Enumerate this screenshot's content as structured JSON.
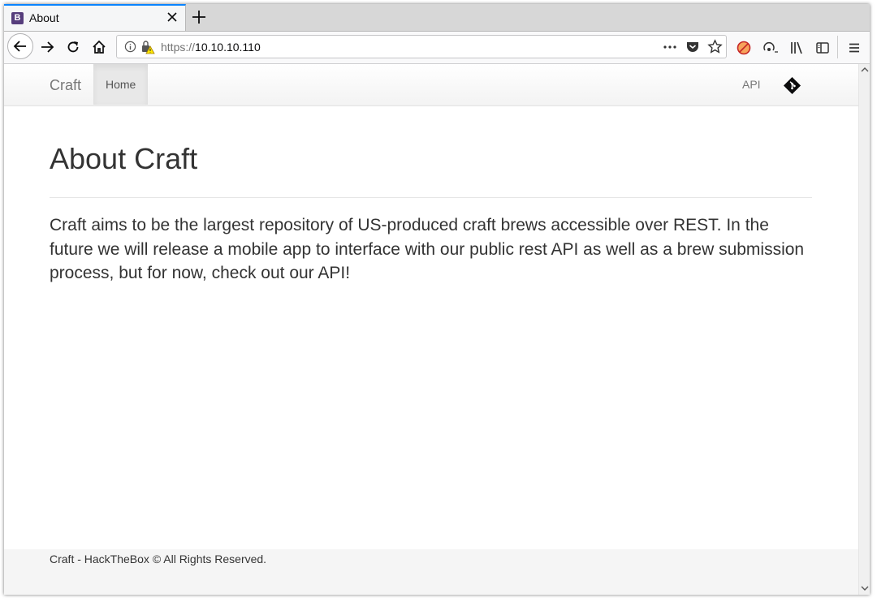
{
  "browser": {
    "tab": {
      "title": "About",
      "favicon_letter": "B"
    },
    "url": {
      "protocol": "https://",
      "host": "10.10.10.110"
    }
  },
  "site": {
    "brand": "Craft",
    "nav": {
      "home": "Home",
      "api": "API"
    }
  },
  "main": {
    "heading": "About Craft",
    "lead": "Craft aims to be the largest repository of US-produced craft brews accessible over REST. In the future we will release a mobile app to interface with our public rest API as well as a brew submission process, but for now, check out our API!"
  },
  "footer": {
    "text": "Craft - HackTheBox © All Rights Reserved."
  },
  "colors": {
    "accent_tab": "#0a84ff",
    "favicon_bg": "#563d7c",
    "text": "#333333"
  }
}
